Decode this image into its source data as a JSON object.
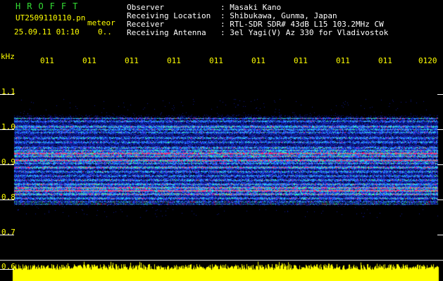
{
  "app": {
    "brand": "HROFFT",
    "filename": "UT2509110110.pn",
    "meteor_label": "meteor",
    "datetime": "25.09.11 01:10",
    "datetime_suffix": "0.."
  },
  "header": {
    "rows": [
      {
        "label": "Observer",
        "value": ": Masaki Kano"
      },
      {
        "label": "Receiving Location",
        "value": ": Shibukawa, Gunma, Japan"
      },
      {
        "label": "Receiver",
        "value": ": RTL-SDR SDR# 43dB L15 103.2MHz CW"
      },
      {
        "label": "Receiving Antenna",
        "value": ": 3el Yagi(V) Az 330 for Vladivostok"
      }
    ]
  },
  "axis": {
    "unit": "kHz",
    "y_ticks": [
      "1.1",
      "1.0",
      "0.9",
      "0.8",
      "0.7",
      "0.6"
    ],
    "x_ticks": [
      "011",
      "011",
      "011",
      "011",
      "011",
      "011",
      "011",
      "011",
      "011",
      "0120"
    ]
  },
  "colors": {
    "background": "#000000",
    "text_header": "#ffffff",
    "brand": "#33dd33",
    "axis_text": "#ffff00",
    "signal_band": "#ff3377",
    "noise_base": "#0a1a8a",
    "amplitude": "#ffff00"
  }
}
